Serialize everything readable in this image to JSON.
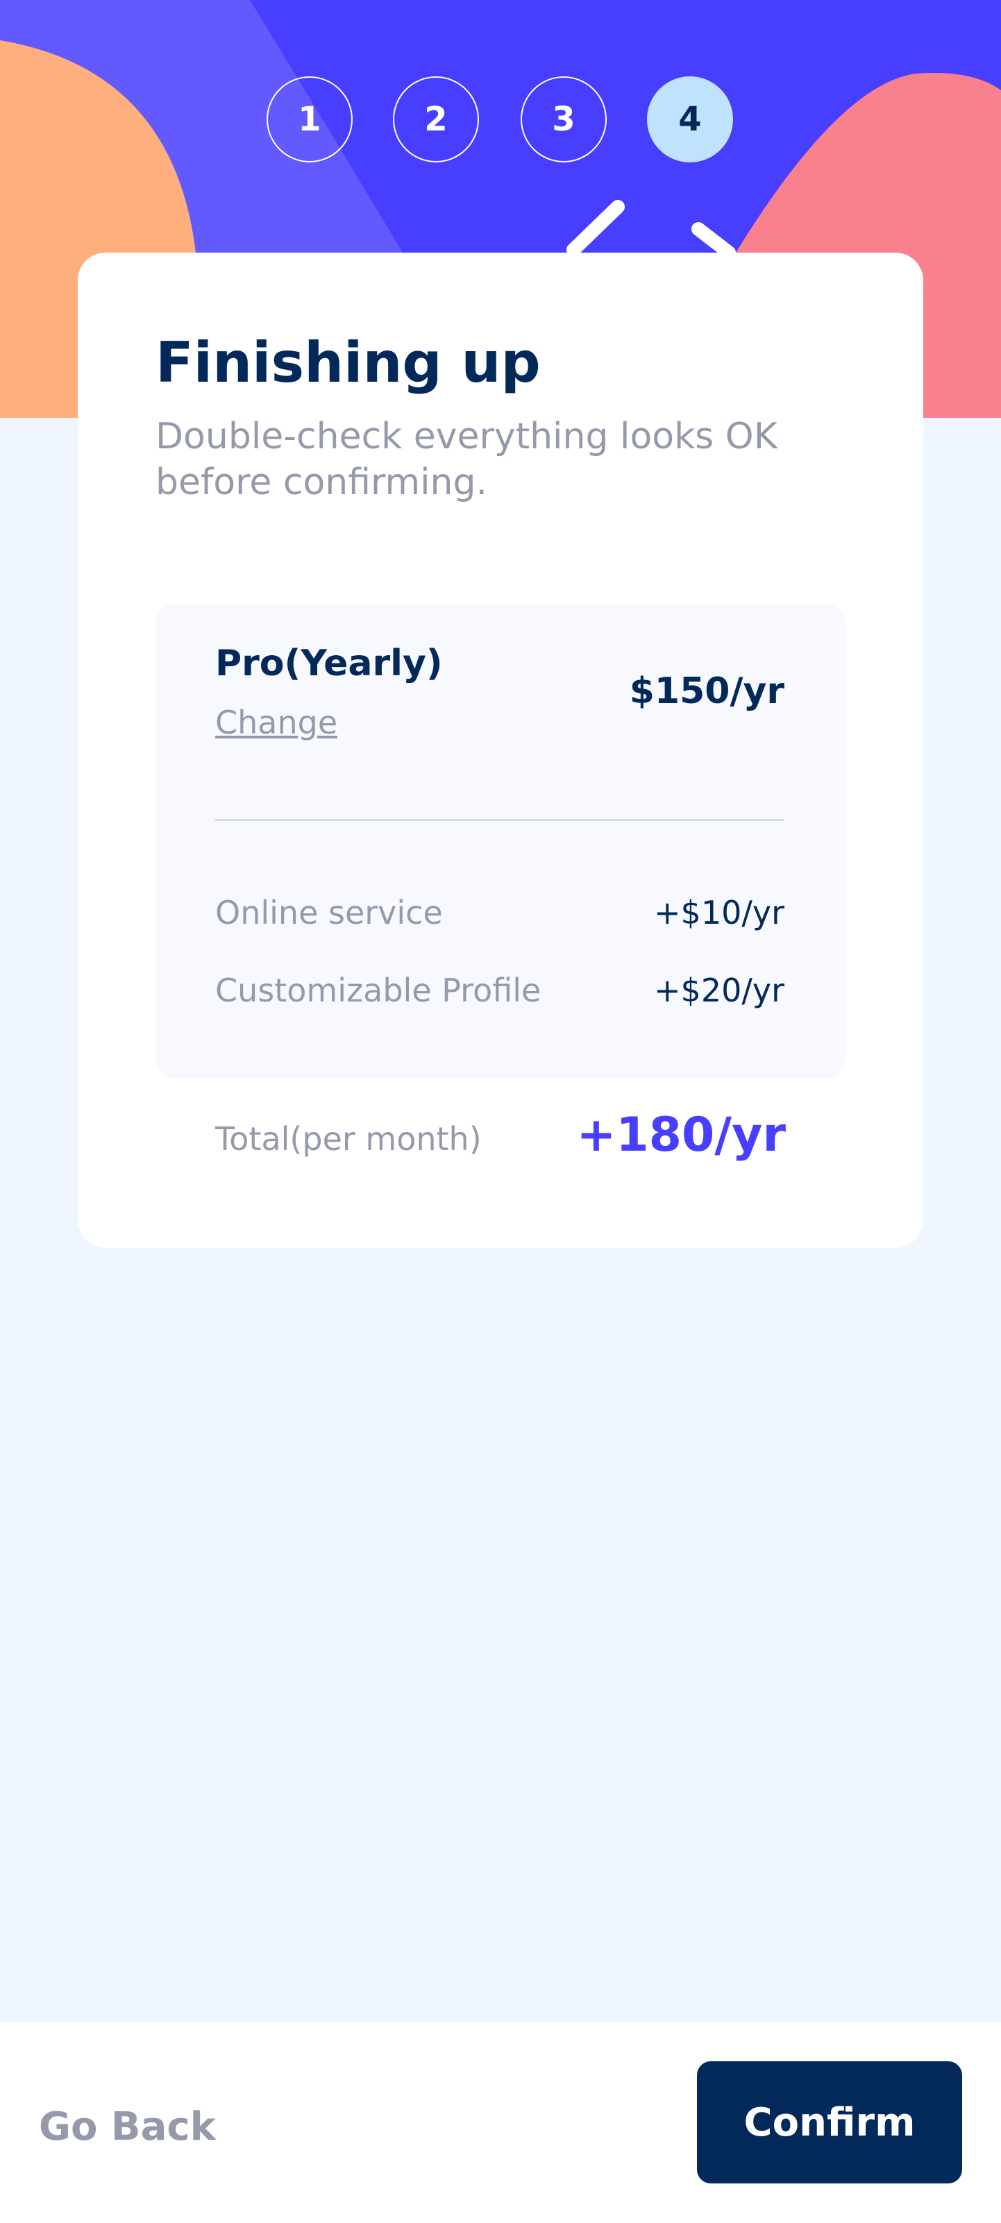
{
  "steps": [
    "1",
    "2",
    "3",
    "4"
  ],
  "active_step": "4",
  "colors": {
    "header_bg": "#483eff",
    "blob_left": "#ffaf7e",
    "blob_right": "#f9818e",
    "blob_light": "#6259ff",
    "active_step_bg": "#bfe2fd",
    "marine_blue": "#022959",
    "purple": "#483eff",
    "cool_gray": "#9699aa",
    "page_bg": "#eef5fe"
  },
  "summary": {
    "title": "Finishing up",
    "subtitle": "Double-check everything looks OK before confirming.",
    "plan": {
      "name": "Pro(Yearly)",
      "change_label": "Change",
      "price": "$150/yr"
    },
    "addons": [
      {
        "name": "Online service",
        "price": "+$10/yr"
      },
      {
        "name": "Customizable Profile",
        "price": "+$20/yr"
      }
    ],
    "total": {
      "label": "Total(per month)",
      "value": "+180/yr"
    }
  },
  "footer": {
    "back_label": "Go Back",
    "confirm_label": "Confirm"
  }
}
